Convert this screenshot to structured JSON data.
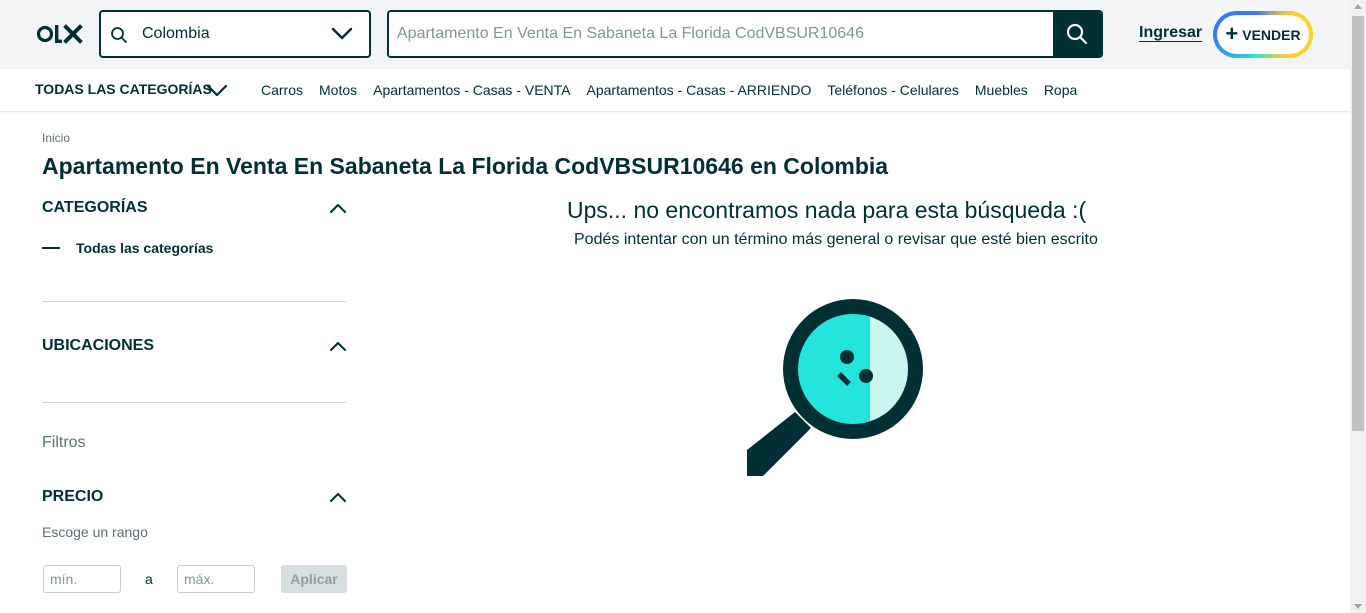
{
  "header": {
    "logo_text": "OLX",
    "location_value": "Colombia",
    "search_placeholder": "Apartamento En Venta En Sabaneta La Florida CodVBSUR10646",
    "login_label": "Ingresar",
    "sell_label": "VENDER",
    "sell_plus": "+"
  },
  "catnav": {
    "all_label": "TODAS LAS CATEGORÍAS",
    "links": [
      "Carros",
      "Motos",
      "Apartamentos - Casas - VENTA",
      "Apartamentos - Casas - ARRIENDO",
      "Teléfonos - Celulares",
      "Muebles",
      "Ropa"
    ]
  },
  "main": {
    "breadcrumb": "Inicio",
    "title": "Apartamento En Venta En Sabaneta La Florida CodVBSUR10646 en Colombia",
    "empty_title": "Ups... no encontramos nada para esta búsqueda :(",
    "empty_sub": "Podés intentar con un término más general o revisar que esté bien escrito"
  },
  "sidebar": {
    "categories_title": "CATEGORÍAS",
    "all_categories": "Todas las categorías",
    "locations_title": "UBICACIONES",
    "filters_label": "Filtros",
    "price_title": "PRECIO",
    "range_label": "Escoge un rango",
    "min_placeholder": "mín.",
    "max_placeholder": "máx.",
    "range_separator": "a",
    "apply_label": "Aplicar"
  },
  "colors": {
    "brand_dark": "#002f34",
    "accent_teal": "#23e5db",
    "accent_blue": "#3a77ff",
    "accent_yellow": "#ffce32"
  }
}
